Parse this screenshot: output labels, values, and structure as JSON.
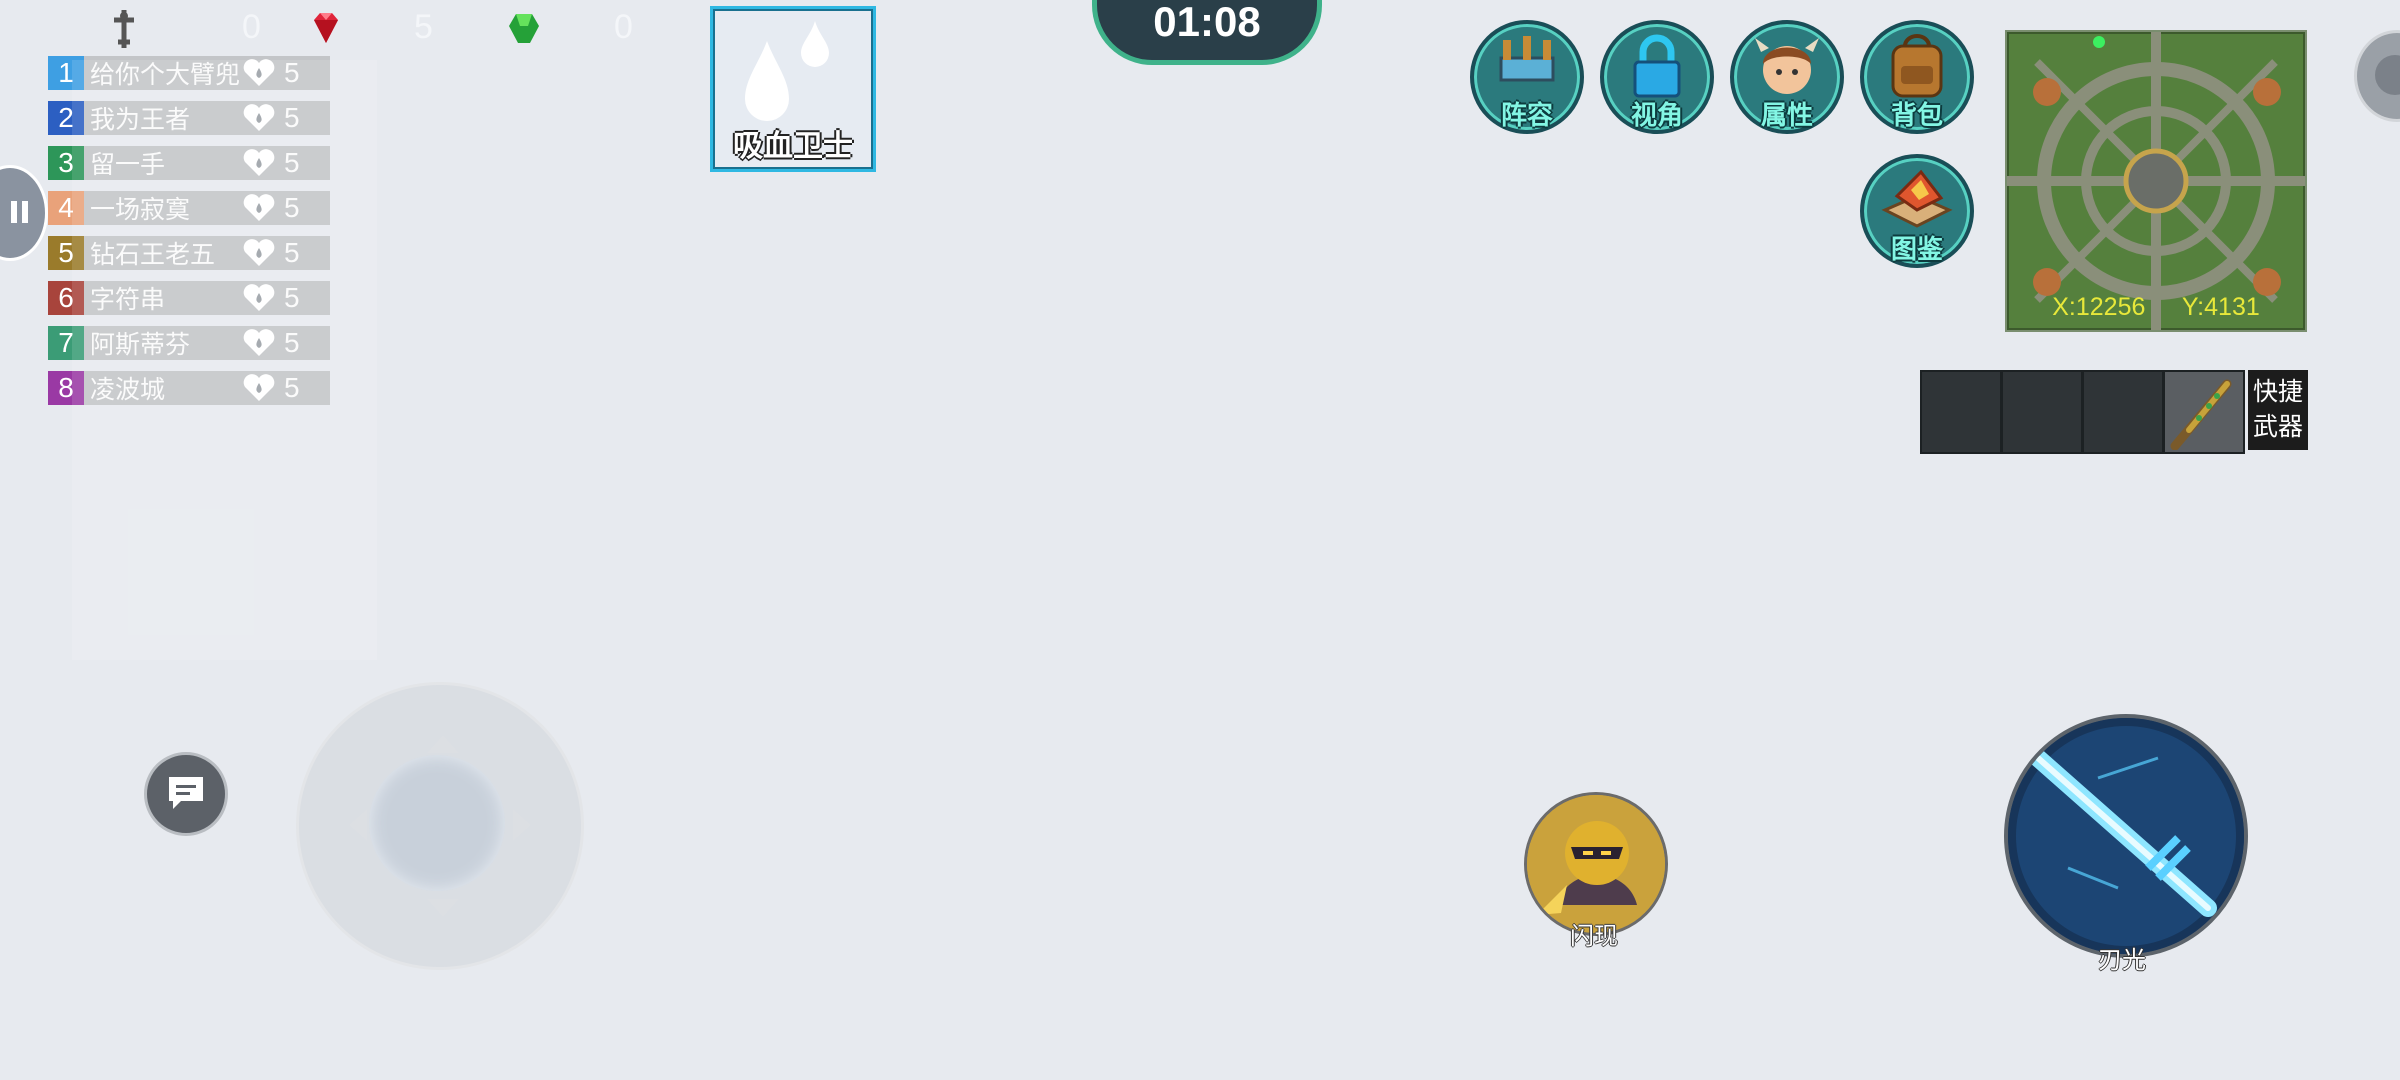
{
  "resources": [
    {
      "icon": "sword-cross-icon",
      "value": "0"
    },
    {
      "icon": "red-gem-icon",
      "value": "5"
    },
    {
      "icon": "green-gem-icon",
      "value": "0"
    }
  ],
  "ranking": [
    {
      "rank": "1",
      "name": "给你个大臂兜",
      "score": "5",
      "color": "#3e9fe3"
    },
    {
      "rank": "2",
      "name": "我为王者",
      "score": "5",
      "color": "#2c5fc2"
    },
    {
      "rank": "3",
      "name": "留一手",
      "score": "5",
      "color": "#2d9659"
    },
    {
      "rank": "4",
      "name": "一场寂寞",
      "score": "5",
      "color": "#e9a27a"
    },
    {
      "rank": "5",
      "name": "钻石王老五",
      "score": "5",
      "color": "#9a7b2b"
    },
    {
      "rank": "6",
      "name": "字符串",
      "score": "5",
      "color": "#a8443c"
    },
    {
      "rank": "7",
      "name": "阿斯蒂芬",
      "score": "5",
      "color": "#3b9c76"
    },
    {
      "rank": "8",
      "name": "凌波城",
      "score": "5",
      "color": "#9a39a4"
    }
  ],
  "buff": {
    "label": "吸血卫士",
    "icon": "blood-drop-icon"
  },
  "timer": "01:08",
  "menu": [
    {
      "label": "阵容",
      "icon": "lineup-icon"
    },
    {
      "label": "视角",
      "icon": "lock-icon"
    },
    {
      "label": "属性",
      "icon": "hero-portrait-icon"
    },
    {
      "label": "背包",
      "icon": "backpack-icon"
    },
    {
      "label": "图鉴",
      "icon": "book-icon"
    }
  ],
  "minimap": {
    "x_label": "X:12256",
    "y_label": "Y:4131"
  },
  "quick_weapon": {
    "label_line1": "快捷",
    "label_line2": "武器",
    "equipped_icon": "spiked-club-icon"
  },
  "skills": {
    "small": "闪现",
    "big": "刃光"
  },
  "colors": {
    "accent": "#3fb28a",
    "buff_border": "#2fb8e2",
    "coords": "#e8e83a"
  }
}
